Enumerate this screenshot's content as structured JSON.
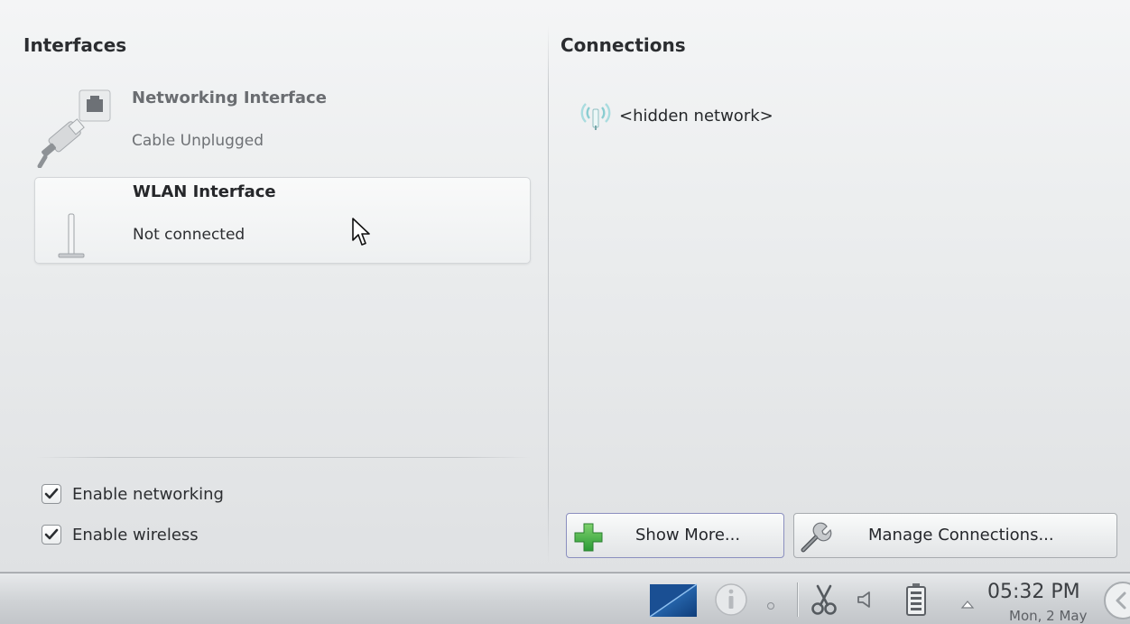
{
  "interfaces": {
    "heading": "Interfaces",
    "items": [
      {
        "title": "Networking Interface",
        "status": "Cable Unplugged",
        "icon": "ethernet-cable-icon"
      },
      {
        "title": "WLAN Interface",
        "status": "Not connected",
        "icon": "wlan-antenna-icon"
      }
    ]
  },
  "options": {
    "enable_networking": {
      "label": "Enable networking",
      "checked": true
    },
    "enable_wireless": {
      "label": "Enable wireless",
      "checked": true
    }
  },
  "connections": {
    "heading": "Connections",
    "items": [
      {
        "label": "<hidden network>",
        "icon": "wireless-signal-icon"
      }
    ]
  },
  "buttons": {
    "show_more": "Show More...",
    "manage_connections": "Manage Connections..."
  },
  "taskbar": {
    "time": "05:32 PM",
    "date": "Mon, 2 May",
    "tray_icons": [
      "network-applet-icon",
      "info-icon",
      "tray-dot-icon",
      "scissors-icon",
      "volume-icon",
      "battery-icon",
      "expand-tray-icon"
    ]
  },
  "colors": {
    "panel_bg": "#eceeef",
    "text": "#25272a",
    "muted_text": "#6a6d71",
    "accent_green": "#2fa838",
    "accent_blue": "#1f5ea8"
  }
}
